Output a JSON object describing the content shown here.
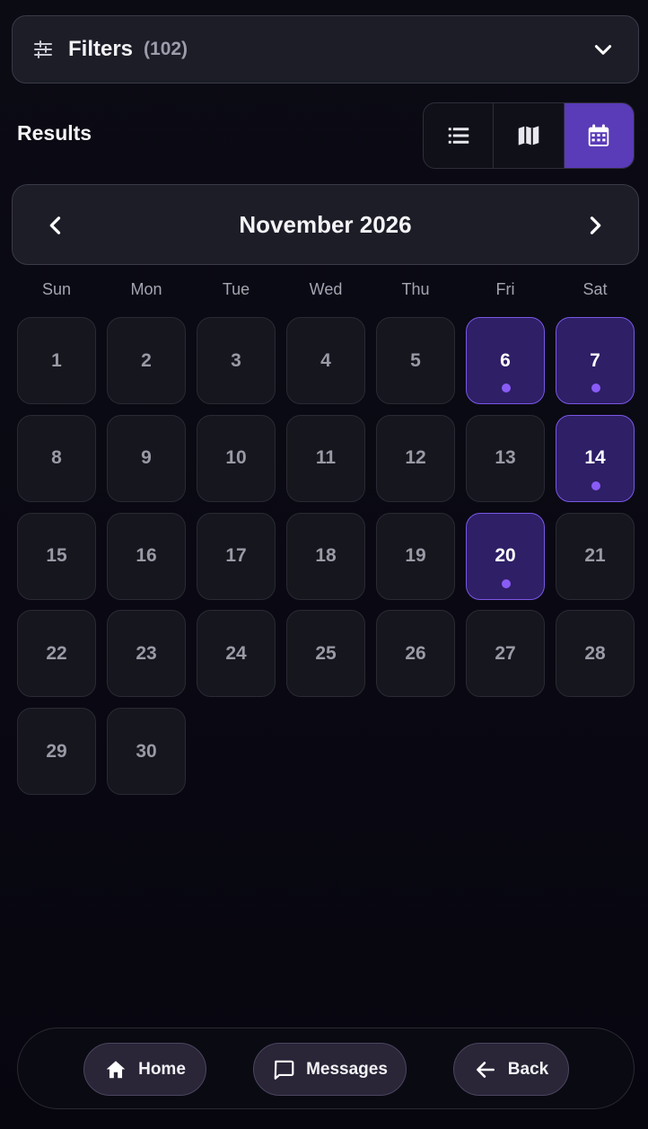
{
  "filters": {
    "label": "Filters",
    "count": "(102)"
  },
  "results": {
    "label": "Results",
    "views": [
      {
        "name": "list",
        "icon": "list-icon",
        "active": false
      },
      {
        "name": "map",
        "icon": "map-icon",
        "active": false
      },
      {
        "name": "calendar",
        "icon": "calendar-icon",
        "active": true
      }
    ]
  },
  "calendar": {
    "month_label": "November 2026",
    "weekdays": [
      "Sun",
      "Mon",
      "Tue",
      "Wed",
      "Thu",
      "Fri",
      "Sat"
    ],
    "days": [
      "1",
      "2",
      "3",
      "4",
      "5",
      "6",
      "7",
      "8",
      "9",
      "10",
      "11",
      "12",
      "13",
      "14",
      "15",
      "16",
      "17",
      "18",
      "19",
      "20",
      "21",
      "22",
      "23",
      "24",
      "25",
      "26",
      "27",
      "28",
      "29",
      "30"
    ],
    "event_days": [
      "6",
      "7",
      "14",
      "20"
    ]
  },
  "bottom_nav": {
    "home": "Home",
    "messages": "Messages",
    "back": "Back"
  },
  "colors": {
    "accent": "#5a3bb8",
    "event_bg": "#2e1f66",
    "event_border": "#7a57e6",
    "event_dot": "#8a5cf6"
  }
}
